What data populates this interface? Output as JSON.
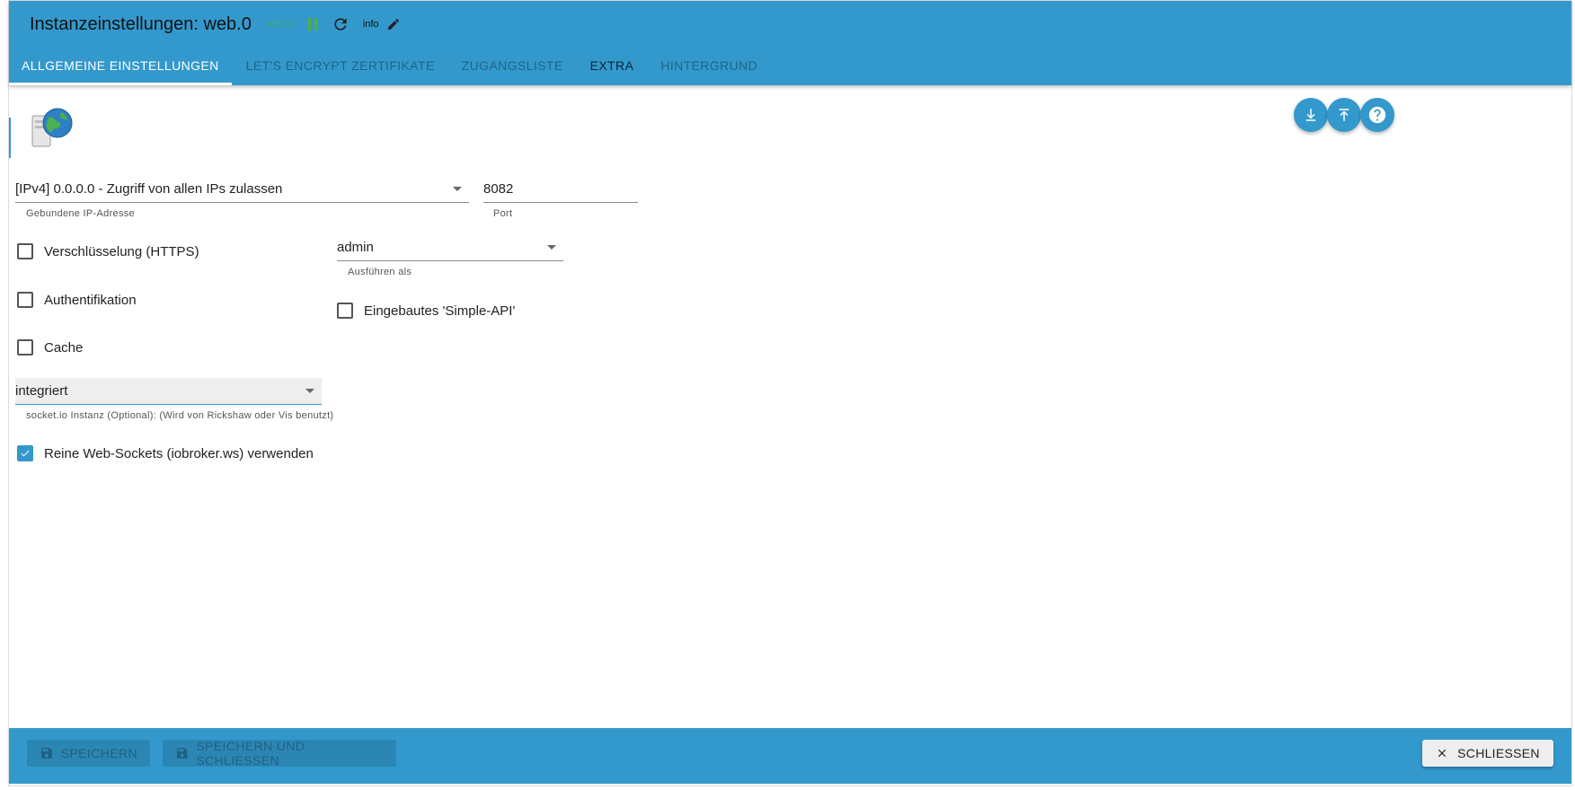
{
  "header": {
    "title": "Instanzeinstellungen: web.0",
    "version": "v6.1.0",
    "info_label": "info",
    "status_color": "#4caf50",
    "accent_color": "#3399cc"
  },
  "tabs": [
    {
      "label": "ALLGEMEINE EINSTELLUNGEN",
      "active": true
    },
    {
      "label": "LET'S ENCRYPT ZERTIFIKATE",
      "active": false
    },
    {
      "label": "ZUGANGSLISTE",
      "active": false
    },
    {
      "label": "EXTRA",
      "active": false
    },
    {
      "label": "HINTERGRUND",
      "active": false
    }
  ],
  "fabs": {
    "download_icon": "download-icon",
    "upload_icon": "upload-icon",
    "help_icon": "help-icon"
  },
  "form": {
    "bind_ip": {
      "value": "[IPv4] 0.0.0.0 - Zugriff von allen IPs zulassen",
      "helper": "Gebundene IP-Adresse"
    },
    "port": {
      "value": "8082",
      "helper": "Port"
    },
    "https": {
      "label": "Verschlüsselung (HTTPS)",
      "checked": false
    },
    "run_as": {
      "value": "admin",
      "helper": "Ausführen als"
    },
    "auth": {
      "label": "Authentifikation",
      "checked": false
    },
    "simple_api": {
      "label": "Eingebautes 'Simple-API'",
      "checked": false
    },
    "cache": {
      "label": "Cache",
      "checked": false
    },
    "socketio": {
      "value": "integriert",
      "helper": "socket.io Instanz (Optional): (Wird von Rickshaw oder Vis benutzt)"
    },
    "pure_ws": {
      "label": "Reine Web-Sockets (iobroker.ws) verwenden",
      "checked": true
    }
  },
  "footer": {
    "save_label": "SPEICHERN",
    "save_close_label": "SPEICHERN UND SCHLIESSEN",
    "close_label": "SCHLIESSEN"
  }
}
